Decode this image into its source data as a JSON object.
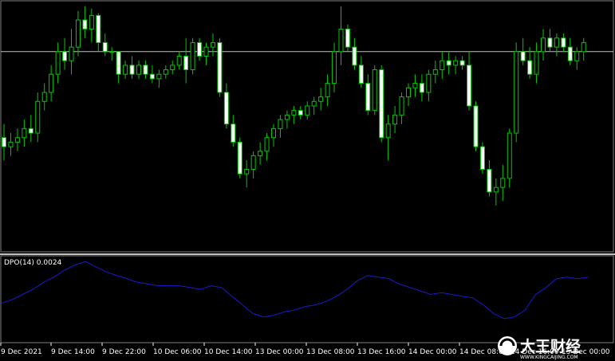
{
  "chart_data": [
    {
      "type": "candlestick",
      "title": "",
      "price_scale_visible": false,
      "horizontal_line": true,
      "colors": {
        "background": "#000000",
        "bull_body": "#000000",
        "bull_outline": "#00c800",
        "bear_body": "#ffffff",
        "wick": "#00c800",
        "hline": "#c0c0c0"
      },
      "x_tick_labels": [
        "9 Dec 2021",
        "9 Dec 14:00",
        "9 Dec 22:00",
        "10 Dec 06:00",
        "10 Dec 14:00",
        "13 Dec 00:00",
        "13 Dec 08:00",
        "13 Dec 16:00",
        "14 Dec 00:00",
        "14 Dec 08:00",
        "14 Dec 16:00",
        "15 Dec 00:00"
      ],
      "ylim": [
        0,
        100
      ],
      "candles": [
        {
          "o": 42,
          "h": 48,
          "l": 32,
          "c": 38
        },
        {
          "o": 38,
          "h": 44,
          "l": 34,
          "c": 40
        },
        {
          "o": 40,
          "h": 46,
          "l": 36,
          "c": 42
        },
        {
          "o": 42,
          "h": 50,
          "l": 38,
          "c": 46
        },
        {
          "o": 46,
          "h": 52,
          "l": 40,
          "c": 44
        },
        {
          "o": 44,
          "h": 62,
          "l": 40,
          "c": 58
        },
        {
          "o": 58,
          "h": 66,
          "l": 54,
          "c": 62
        },
        {
          "o": 62,
          "h": 74,
          "l": 58,
          "c": 70
        },
        {
          "o": 70,
          "h": 84,
          "l": 66,
          "c": 80
        },
        {
          "o": 80,
          "h": 86,
          "l": 72,
          "c": 76
        },
        {
          "o": 76,
          "h": 90,
          "l": 70,
          "c": 82
        },
        {
          "o": 82,
          "h": 98,
          "l": 78,
          "c": 94
        },
        {
          "o": 94,
          "h": 100,
          "l": 86,
          "c": 90
        },
        {
          "o": 90,
          "h": 99,
          "l": 84,
          "c": 96
        },
        {
          "o": 96,
          "h": 97,
          "l": 80,
          "c": 84
        },
        {
          "o": 84,
          "h": 88,
          "l": 78,
          "c": 80
        },
        {
          "o": 80,
          "h": 82,
          "l": 76,
          "c": 80
        },
        {
          "o": 80,
          "h": 80,
          "l": 66,
          "c": 70
        },
        {
          "o": 70,
          "h": 76,
          "l": 68,
          "c": 74
        },
        {
          "o": 74,
          "h": 78,
          "l": 68,
          "c": 70
        },
        {
          "o": 70,
          "h": 76,
          "l": 68,
          "c": 74
        },
        {
          "o": 74,
          "h": 76,
          "l": 68,
          "c": 70
        },
        {
          "o": 70,
          "h": 74,
          "l": 66,
          "c": 68
        },
        {
          "o": 68,
          "h": 72,
          "l": 64,
          "c": 70
        },
        {
          "o": 70,
          "h": 74,
          "l": 68,
          "c": 72
        },
        {
          "o": 72,
          "h": 76,
          "l": 70,
          "c": 74
        },
        {
          "o": 74,
          "h": 80,
          "l": 72,
          "c": 78
        },
        {
          "o": 78,
          "h": 86,
          "l": 66,
          "c": 72
        },
        {
          "o": 72,
          "h": 86,
          "l": 70,
          "c": 84
        },
        {
          "o": 84,
          "h": 86,
          "l": 76,
          "c": 78
        },
        {
          "o": 78,
          "h": 84,
          "l": 74,
          "c": 82
        },
        {
          "o": 82,
          "h": 88,
          "l": 78,
          "c": 84
        },
        {
          "o": 84,
          "h": 86,
          "l": 60,
          "c": 62
        },
        {
          "o": 62,
          "h": 66,
          "l": 46,
          "c": 48
        },
        {
          "o": 48,
          "h": 52,
          "l": 38,
          "c": 40
        },
        {
          "o": 40,
          "h": 42,
          "l": 24,
          "c": 26
        },
        {
          "o": 26,
          "h": 32,
          "l": 20,
          "c": 28
        },
        {
          "o": 28,
          "h": 36,
          "l": 24,
          "c": 34
        },
        {
          "o": 34,
          "h": 40,
          "l": 30,
          "c": 36
        },
        {
          "o": 36,
          "h": 44,
          "l": 32,
          "c": 42
        },
        {
          "o": 42,
          "h": 48,
          "l": 38,
          "c": 46
        },
        {
          "o": 46,
          "h": 52,
          "l": 42,
          "c": 50
        },
        {
          "o": 50,
          "h": 54,
          "l": 46,
          "c": 52
        },
        {
          "o": 52,
          "h": 56,
          "l": 48,
          "c": 54
        },
        {
          "o": 54,
          "h": 56,
          "l": 50,
          "c": 52
        },
        {
          "o": 52,
          "h": 58,
          "l": 50,
          "c": 56
        },
        {
          "o": 56,
          "h": 60,
          "l": 52,
          "c": 58
        },
        {
          "o": 58,
          "h": 64,
          "l": 54,
          "c": 60
        },
        {
          "o": 60,
          "h": 70,
          "l": 56,
          "c": 66
        },
        {
          "o": 66,
          "h": 84,
          "l": 62,
          "c": 80
        },
        {
          "o": 80,
          "h": 100,
          "l": 74,
          "c": 90
        },
        {
          "o": 90,
          "h": 92,
          "l": 80,
          "c": 82
        },
        {
          "o": 82,
          "h": 86,
          "l": 72,
          "c": 74
        },
        {
          "o": 74,
          "h": 78,
          "l": 64,
          "c": 66
        },
        {
          "o": 66,
          "h": 70,
          "l": 52,
          "c": 54
        },
        {
          "o": 54,
          "h": 74,
          "l": 52,
          "c": 72
        },
        {
          "o": 72,
          "h": 74,
          "l": 40,
          "c": 42
        },
        {
          "o": 42,
          "h": 52,
          "l": 32,
          "c": 48
        },
        {
          "o": 48,
          "h": 56,
          "l": 44,
          "c": 52
        },
        {
          "o": 52,
          "h": 62,
          "l": 48,
          "c": 60
        },
        {
          "o": 60,
          "h": 66,
          "l": 56,
          "c": 64
        },
        {
          "o": 64,
          "h": 70,
          "l": 60,
          "c": 66
        },
        {
          "o": 66,
          "h": 70,
          "l": 58,
          "c": 62
        },
        {
          "o": 62,
          "h": 72,
          "l": 58,
          "c": 70
        },
        {
          "o": 70,
          "h": 76,
          "l": 66,
          "c": 72
        },
        {
          "o": 72,
          "h": 80,
          "l": 68,
          "c": 76
        },
        {
          "o": 76,
          "h": 80,
          "l": 70,
          "c": 74
        },
        {
          "o": 74,
          "h": 78,
          "l": 70,
          "c": 76
        },
        {
          "o": 76,
          "h": 78,
          "l": 72,
          "c": 74
        },
        {
          "o": 74,
          "h": 80,
          "l": 54,
          "c": 56
        },
        {
          "o": 56,
          "h": 58,
          "l": 36,
          "c": 38
        },
        {
          "o": 38,
          "h": 40,
          "l": 26,
          "c": 28
        },
        {
          "o": 28,
          "h": 32,
          "l": 16,
          "c": 18
        },
        {
          "o": 18,
          "h": 24,
          "l": 12,
          "c": 20
        },
        {
          "o": 20,
          "h": 30,
          "l": 14,
          "c": 24
        },
        {
          "o": 24,
          "h": 46,
          "l": 20,
          "c": 44
        },
        {
          "o": 44,
          "h": 84,
          "l": 40,
          "c": 80
        },
        {
          "o": 80,
          "h": 86,
          "l": 74,
          "c": 76
        },
        {
          "o": 76,
          "h": 82,
          "l": 68,
          "c": 70
        },
        {
          "o": 70,
          "h": 84,
          "l": 66,
          "c": 80
        },
        {
          "o": 80,
          "h": 90,
          "l": 76,
          "c": 86
        },
        {
          "o": 86,
          "h": 90,
          "l": 80,
          "c": 82
        },
        {
          "o": 82,
          "h": 88,
          "l": 78,
          "c": 86
        },
        {
          "o": 86,
          "h": 88,
          "l": 80,
          "c": 82
        },
        {
          "o": 82,
          "h": 86,
          "l": 74,
          "c": 76
        },
        {
          "o": 76,
          "h": 82,
          "l": 72,
          "c": 80
        },
        {
          "o": 80,
          "h": 86,
          "l": 76,
          "c": 84
        }
      ]
    },
    {
      "type": "line",
      "title": "DPO(14) 0.0024",
      "indicator": "DPO",
      "period": 14,
      "current_value": "0.0024",
      "colors": {
        "line": "#1a1ad0"
      },
      "ylim": [
        -1.2,
        1.1
      ],
      "values": [
        -0.15,
        -0.05,
        0.1,
        0.25,
        0.45,
        0.6,
        0.8,
        0.95,
        1.05,
        0.9,
        0.75,
        0.65,
        0.55,
        0.45,
        0.4,
        0.35,
        0.35,
        0.35,
        0.3,
        0.25,
        0.35,
        0.3,
        0.05,
        -0.2,
        -0.45,
        -0.55,
        -0.5,
        -0.4,
        -0.35,
        -0.25,
        -0.2,
        -0.1,
        0.05,
        0.25,
        0.5,
        0.65,
        0.6,
        0.55,
        0.4,
        0.3,
        0.2,
        0.1,
        0.15,
        0.1,
        0.05,
        0.0,
        -0.2,
        -0.45,
        -0.6,
        -0.55,
        -0.35,
        0.1,
        0.3,
        0.55,
        0.6,
        0.55,
        0.6
      ]
    }
  ]
}
